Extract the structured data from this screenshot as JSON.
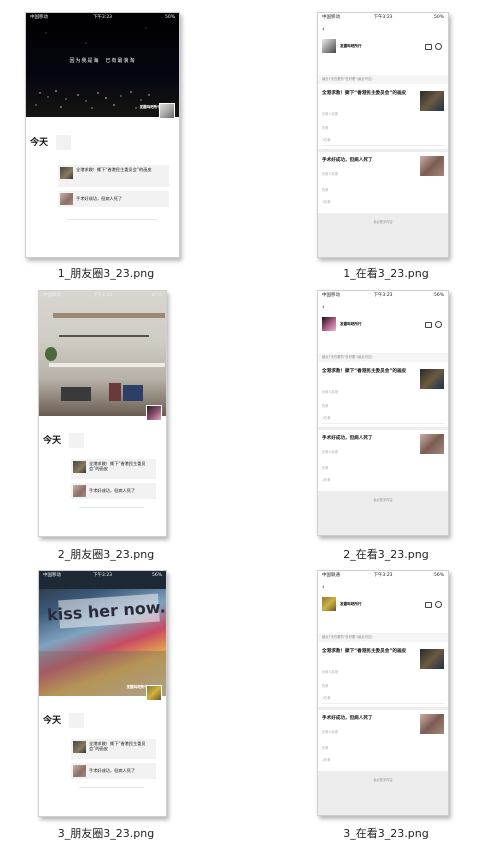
{
  "status": {
    "carrier": "中国移动",
    "carrier_alt": "中国联通",
    "time": "下午3:23",
    "battery_1": "50%",
    "battery_2": "56%",
    "battery_3": "87%"
  },
  "moments": {
    "cover1_text": "因为我是海　已有最浪淘",
    "nickname": "发霆吗吧所行",
    "today": "今天",
    "item1": "全港求救！撕下“香港民主委员会”的画皮",
    "item2": "手术好成功，但病人死了"
  },
  "watching": {
    "back": "‹",
    "username": "发霆吗吧所行",
    "notice": "最近7天在看的\"在好看\"(最近可见)",
    "article1_title": "全港求救！撕下“香港民主委员会”的画皮",
    "article2_title": "手术好成功，但病人死了",
    "source": "乐维人民报",
    "views": "1在看",
    "seen": "在看",
    "footer": "最近更多内容"
  },
  "captions": [
    "1_朋友圈3_23.png",
    "1_在看3_23.png",
    "2_朋友圈3_23.png",
    "2_在看3_23.png",
    "3_朋友圈3_23.png",
    "3_在看3_23.png"
  ],
  "colors": {
    "thumb_border": "#cfcfcf",
    "gray_bg": "#ededed",
    "row_bg": "#f2f2f2"
  }
}
